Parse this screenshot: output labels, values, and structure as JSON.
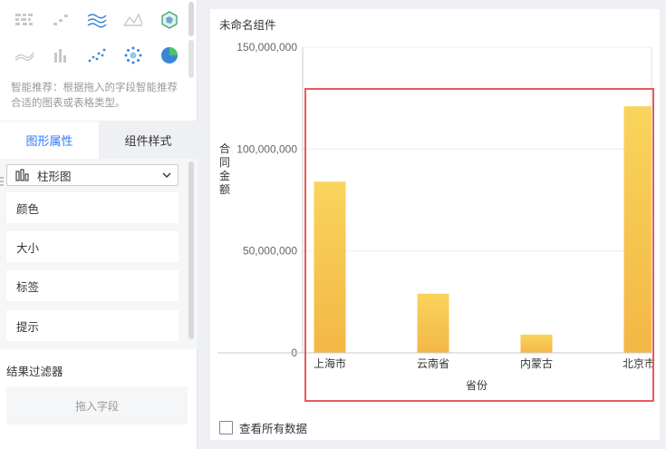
{
  "left_panel": {
    "chart_types": [
      {
        "icon": "matrix-icon"
      },
      {
        "icon": "scatter-small-icon"
      },
      {
        "icon": "multi-line-icon"
      },
      {
        "icon": "line-trend-icon"
      },
      {
        "icon": "radar-icon"
      },
      {
        "icon": "area-line-icon"
      },
      {
        "icon": "bar-small-icon"
      },
      {
        "icon": "dot-scatter-icon"
      },
      {
        "icon": "bubble-ring-icon"
      },
      {
        "icon": "pie-icon"
      }
    ],
    "hint": "智能推荐：根据拖入的字段智能推荐合适的图表或表格类型。",
    "tabs": [
      {
        "label": "图形属性",
        "active": true
      },
      {
        "label": "组件样式",
        "active": false
      }
    ],
    "chart_select": "柱形图",
    "properties": [
      {
        "label": "颜色"
      },
      {
        "label": "大小"
      },
      {
        "label": "标签"
      },
      {
        "label": "提示"
      }
    ],
    "filter_title": "结果过滤器",
    "drop_placeholder": "拖入字段"
  },
  "main": {
    "title": "未命名组件",
    "show_all_label": "查看所有数据"
  },
  "colors": {
    "accent": "#2f7cf6",
    "bar_top": "#f9d45c",
    "bar_bottom": "#f3b746",
    "highlight_box": "#e55b5b"
  },
  "chart_data": {
    "type": "bar",
    "categories": [
      "上海市",
      "云南省",
      "内蒙古",
      "北京市"
    ],
    "values": [
      84000000,
      29000000,
      9000000,
      121000000
    ],
    "xlabel": "省份",
    "ylabel": "合同金额",
    "ylim": [
      0,
      150000000
    ],
    "y_ticks": [
      {
        "value": 0,
        "label": "0"
      },
      {
        "value": 50000000,
        "label": "50,000,000"
      },
      {
        "value": 100000000,
        "label": "100,000,000"
      },
      {
        "value": 150000000,
        "label": "150,000,000"
      }
    ],
    "grid": true
  }
}
